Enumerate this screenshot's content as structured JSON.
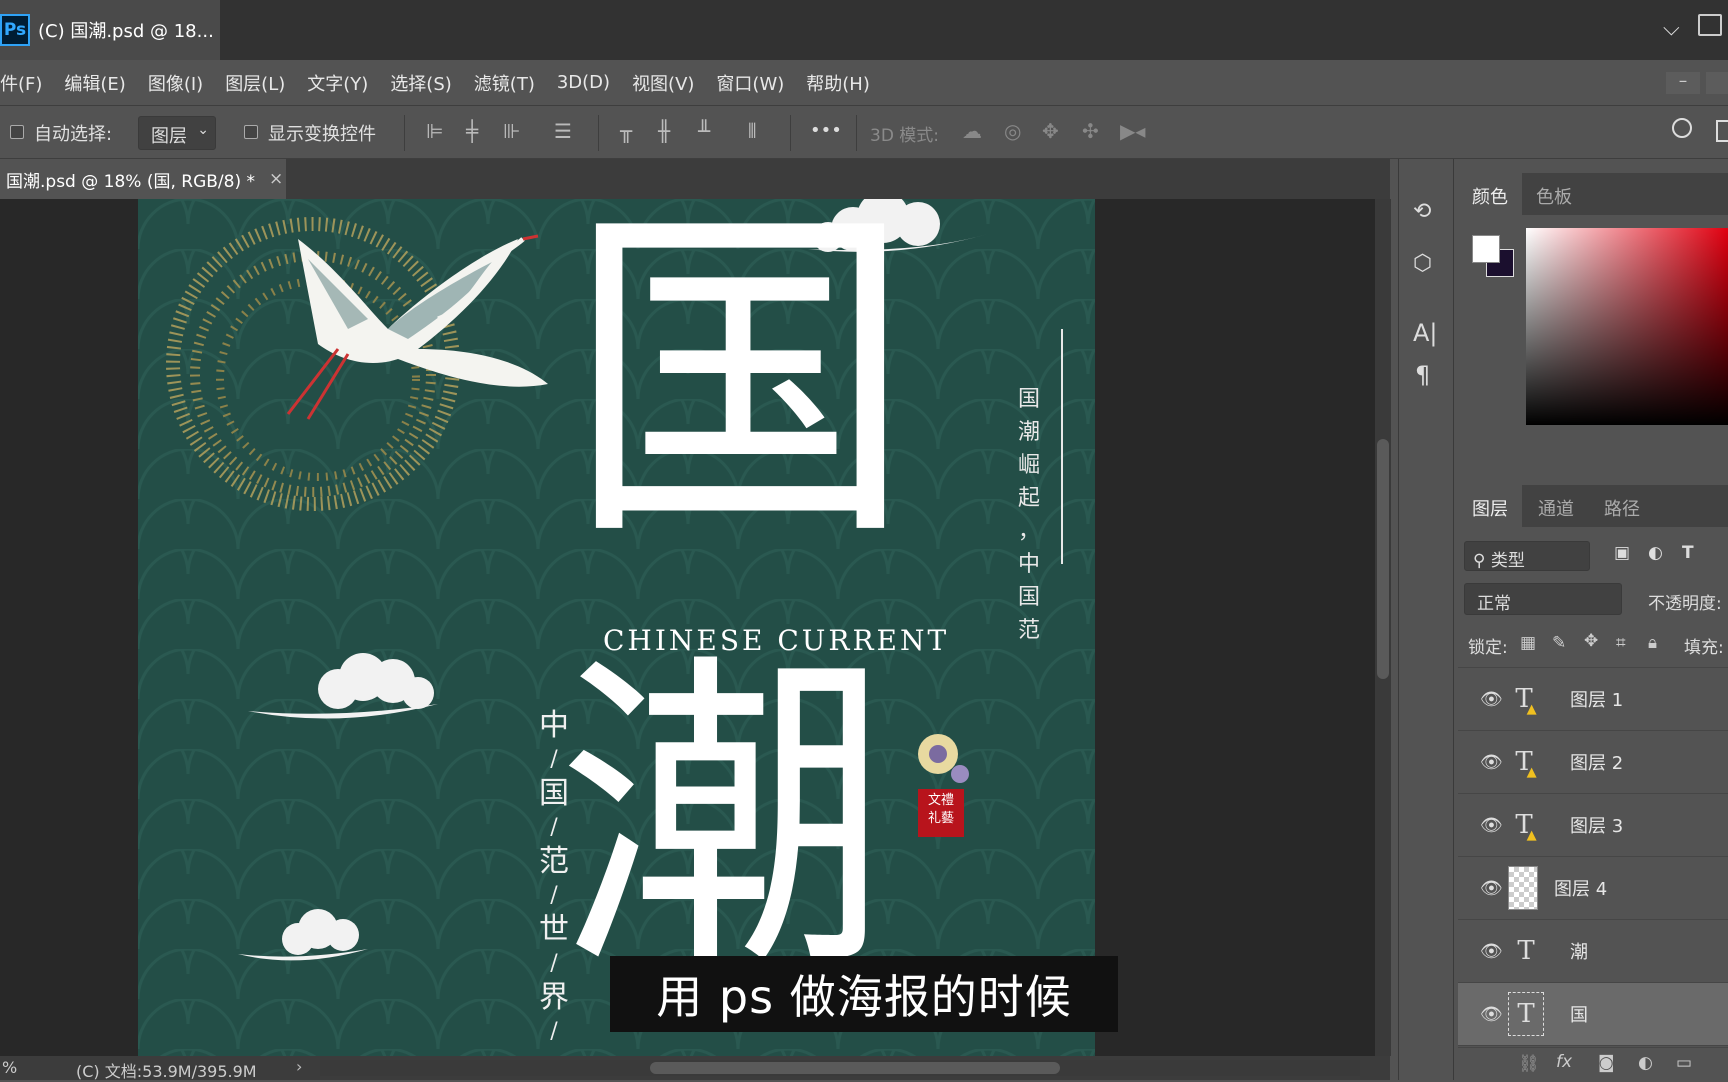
{
  "app": {
    "logo": "Ps",
    "tab_title": "(C) 国潮.psd @ 18..."
  },
  "menu": [
    "件(F)",
    "编辑(E)",
    "图像(I)",
    "图层(L)",
    "文字(Y)",
    "选择(S)",
    "滤镜(T)",
    "3D(D)",
    "视图(V)",
    "窗口(W)",
    "帮助(H)"
  ],
  "options": {
    "auto_select_label": "自动选择:",
    "auto_select_value": "图层",
    "show_transform_label": "显示变换控件",
    "more": "•••",
    "mode3d_label": "3D 模式:"
  },
  "doc_tab": {
    "title": "国潮.psd @ 18% (国, RGB/8) *",
    "close": "×"
  },
  "poster": {
    "big_char_1": "国",
    "big_char_2": "潮",
    "english": "CHINESE CURRENT",
    "vertical_right": [
      "国",
      "潮",
      "崛",
      "起",
      "，",
      "中",
      "国",
      "范"
    ],
    "vertical_left": [
      "中",
      "/",
      "国",
      "/",
      "范",
      "/",
      "世",
      "/",
      "界",
      "/"
    ],
    "seal": "文禮 礼藝"
  },
  "status": {
    "zoom": "%",
    "doc": "(C) 文档:53.9M/395.9M"
  },
  "panels": {
    "color_tabs": [
      "颜色",
      "色板"
    ],
    "layer_tabs": [
      "图层",
      "通道",
      "路径"
    ],
    "filter_label": "类型",
    "blend_mode": "正常",
    "opacity_label": "不透明度:",
    "lock_label": "锁定:",
    "fill_label": "填充:",
    "layers": [
      {
        "name": "图层 1",
        "kind": "text-warning"
      },
      {
        "name": "图层 2",
        "kind": "text-warning"
      },
      {
        "name": "图层 3",
        "kind": "text-warning"
      },
      {
        "name": "图层 4",
        "kind": "smart-object"
      },
      {
        "name": "潮",
        "kind": "text"
      },
      {
        "name": "国",
        "kind": "text-selected"
      }
    ]
  },
  "subtitle": "用 ps 做海报的时候",
  "colors": {
    "poster_bg": "#234e47",
    "foreground": "#ffffff",
    "background": "#1b0f2e",
    "ps_blue": "#31a8ff"
  }
}
